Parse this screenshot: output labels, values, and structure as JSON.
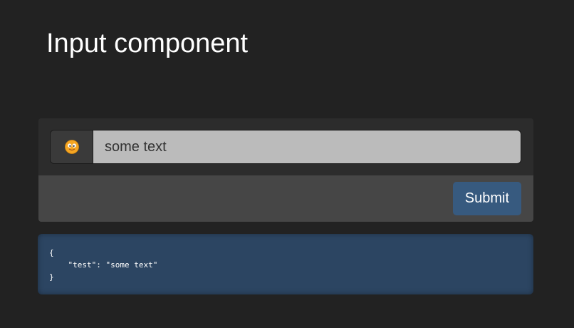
{
  "page": {
    "title": "Input component"
  },
  "form": {
    "addon_icon": "smiley-face-icon",
    "input_value": "some text",
    "submit_label": "Submit"
  },
  "output": {
    "json_text": "{\n    \"test\": \"some text\"\n}"
  },
  "colors": {
    "background": "#222222",
    "card_body": "#2c2c2c",
    "card_footer": "#464646",
    "input_bg": "#bbbbbb",
    "primary_button": "#375a7f",
    "output_bg": "#2c4562"
  }
}
